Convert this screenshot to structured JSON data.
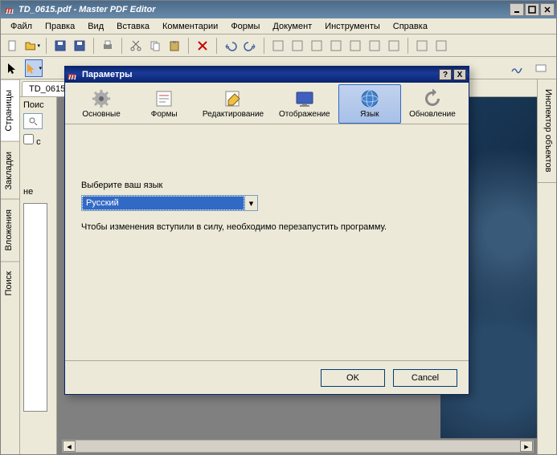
{
  "window": {
    "title": "TD_0615.pdf - Master PDF Editor"
  },
  "menu": [
    "Файл",
    "Правка",
    "Вид",
    "Вставка",
    "Комментарии",
    "Формы",
    "Документ",
    "Инструменты",
    "Справка"
  ],
  "doc_tab": "TD_0615.pd...",
  "left_panel": {
    "search_label": "Поис",
    "case_label": "с"
  },
  "side_tabs_left": [
    "Страницы",
    "Закладки",
    "Вложения",
    "Поиск"
  ],
  "side_tabs_right": [
    "Инспектор объектов"
  ],
  "dialog": {
    "title": "Параметры",
    "tabs": [
      {
        "label": "Основные"
      },
      {
        "label": "Формы"
      },
      {
        "label": "Редактирование"
      },
      {
        "label": "Отображение"
      },
      {
        "label": "Язык"
      },
      {
        "label": "Обновление"
      }
    ],
    "active_tab_index": 4,
    "field_label": "Выберите ваш язык",
    "language_value": "Русский",
    "hint": "Чтобы изменения вступили в силу, необходимо перезапустить программу.",
    "ok": "OK",
    "cancel": "Cancel",
    "help": "?",
    "close": "X"
  },
  "left_hint": "не"
}
